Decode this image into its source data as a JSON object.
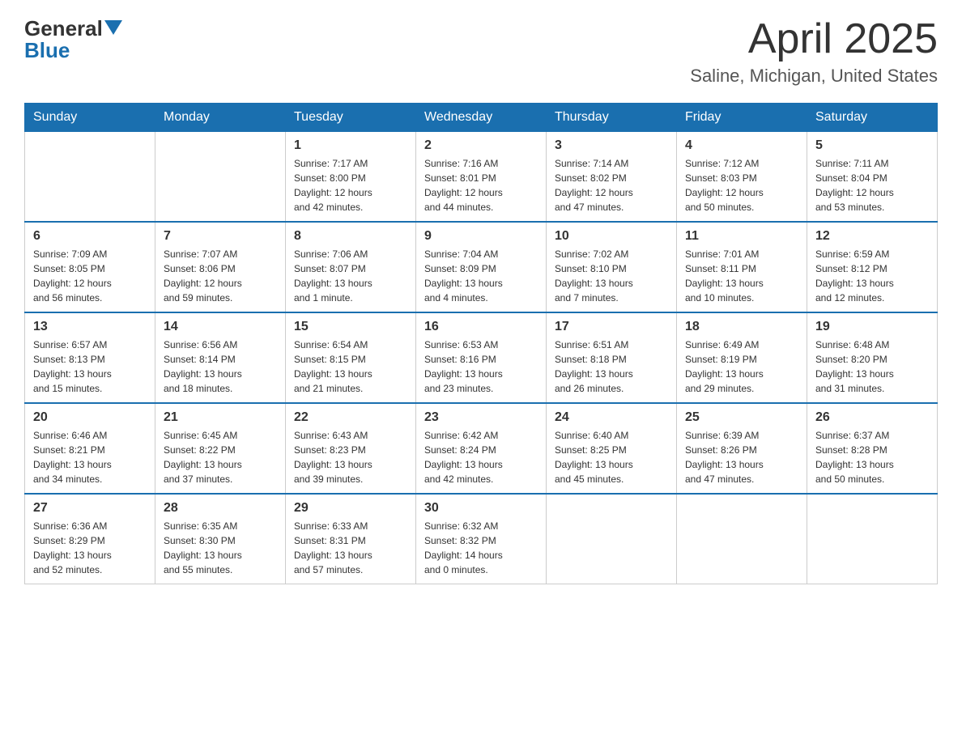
{
  "header": {
    "logo": {
      "general": "General",
      "blue": "Blue"
    },
    "title": "April 2025",
    "location": "Saline, Michigan, United States"
  },
  "weekdays": [
    "Sunday",
    "Monday",
    "Tuesday",
    "Wednesday",
    "Thursday",
    "Friday",
    "Saturday"
  ],
  "weeks": [
    [
      {
        "day": "",
        "info": ""
      },
      {
        "day": "",
        "info": ""
      },
      {
        "day": "1",
        "info": "Sunrise: 7:17 AM\nSunset: 8:00 PM\nDaylight: 12 hours\nand 42 minutes."
      },
      {
        "day": "2",
        "info": "Sunrise: 7:16 AM\nSunset: 8:01 PM\nDaylight: 12 hours\nand 44 minutes."
      },
      {
        "day": "3",
        "info": "Sunrise: 7:14 AM\nSunset: 8:02 PM\nDaylight: 12 hours\nand 47 minutes."
      },
      {
        "day": "4",
        "info": "Sunrise: 7:12 AM\nSunset: 8:03 PM\nDaylight: 12 hours\nand 50 minutes."
      },
      {
        "day": "5",
        "info": "Sunrise: 7:11 AM\nSunset: 8:04 PM\nDaylight: 12 hours\nand 53 minutes."
      }
    ],
    [
      {
        "day": "6",
        "info": "Sunrise: 7:09 AM\nSunset: 8:05 PM\nDaylight: 12 hours\nand 56 minutes."
      },
      {
        "day": "7",
        "info": "Sunrise: 7:07 AM\nSunset: 8:06 PM\nDaylight: 12 hours\nand 59 minutes."
      },
      {
        "day": "8",
        "info": "Sunrise: 7:06 AM\nSunset: 8:07 PM\nDaylight: 13 hours\nand 1 minute."
      },
      {
        "day": "9",
        "info": "Sunrise: 7:04 AM\nSunset: 8:09 PM\nDaylight: 13 hours\nand 4 minutes."
      },
      {
        "day": "10",
        "info": "Sunrise: 7:02 AM\nSunset: 8:10 PM\nDaylight: 13 hours\nand 7 minutes."
      },
      {
        "day": "11",
        "info": "Sunrise: 7:01 AM\nSunset: 8:11 PM\nDaylight: 13 hours\nand 10 minutes."
      },
      {
        "day": "12",
        "info": "Sunrise: 6:59 AM\nSunset: 8:12 PM\nDaylight: 13 hours\nand 12 minutes."
      }
    ],
    [
      {
        "day": "13",
        "info": "Sunrise: 6:57 AM\nSunset: 8:13 PM\nDaylight: 13 hours\nand 15 minutes."
      },
      {
        "day": "14",
        "info": "Sunrise: 6:56 AM\nSunset: 8:14 PM\nDaylight: 13 hours\nand 18 minutes."
      },
      {
        "day": "15",
        "info": "Sunrise: 6:54 AM\nSunset: 8:15 PM\nDaylight: 13 hours\nand 21 minutes."
      },
      {
        "day": "16",
        "info": "Sunrise: 6:53 AM\nSunset: 8:16 PM\nDaylight: 13 hours\nand 23 minutes."
      },
      {
        "day": "17",
        "info": "Sunrise: 6:51 AM\nSunset: 8:18 PM\nDaylight: 13 hours\nand 26 minutes."
      },
      {
        "day": "18",
        "info": "Sunrise: 6:49 AM\nSunset: 8:19 PM\nDaylight: 13 hours\nand 29 minutes."
      },
      {
        "day": "19",
        "info": "Sunrise: 6:48 AM\nSunset: 8:20 PM\nDaylight: 13 hours\nand 31 minutes."
      }
    ],
    [
      {
        "day": "20",
        "info": "Sunrise: 6:46 AM\nSunset: 8:21 PM\nDaylight: 13 hours\nand 34 minutes."
      },
      {
        "day": "21",
        "info": "Sunrise: 6:45 AM\nSunset: 8:22 PM\nDaylight: 13 hours\nand 37 minutes."
      },
      {
        "day": "22",
        "info": "Sunrise: 6:43 AM\nSunset: 8:23 PM\nDaylight: 13 hours\nand 39 minutes."
      },
      {
        "day": "23",
        "info": "Sunrise: 6:42 AM\nSunset: 8:24 PM\nDaylight: 13 hours\nand 42 minutes."
      },
      {
        "day": "24",
        "info": "Sunrise: 6:40 AM\nSunset: 8:25 PM\nDaylight: 13 hours\nand 45 minutes."
      },
      {
        "day": "25",
        "info": "Sunrise: 6:39 AM\nSunset: 8:26 PM\nDaylight: 13 hours\nand 47 minutes."
      },
      {
        "day": "26",
        "info": "Sunrise: 6:37 AM\nSunset: 8:28 PM\nDaylight: 13 hours\nand 50 minutes."
      }
    ],
    [
      {
        "day": "27",
        "info": "Sunrise: 6:36 AM\nSunset: 8:29 PM\nDaylight: 13 hours\nand 52 minutes."
      },
      {
        "day": "28",
        "info": "Sunrise: 6:35 AM\nSunset: 8:30 PM\nDaylight: 13 hours\nand 55 minutes."
      },
      {
        "day": "29",
        "info": "Sunrise: 6:33 AM\nSunset: 8:31 PM\nDaylight: 13 hours\nand 57 minutes."
      },
      {
        "day": "30",
        "info": "Sunrise: 6:32 AM\nSunset: 8:32 PM\nDaylight: 14 hours\nand 0 minutes."
      },
      {
        "day": "",
        "info": ""
      },
      {
        "day": "",
        "info": ""
      },
      {
        "day": "",
        "info": ""
      }
    ]
  ]
}
